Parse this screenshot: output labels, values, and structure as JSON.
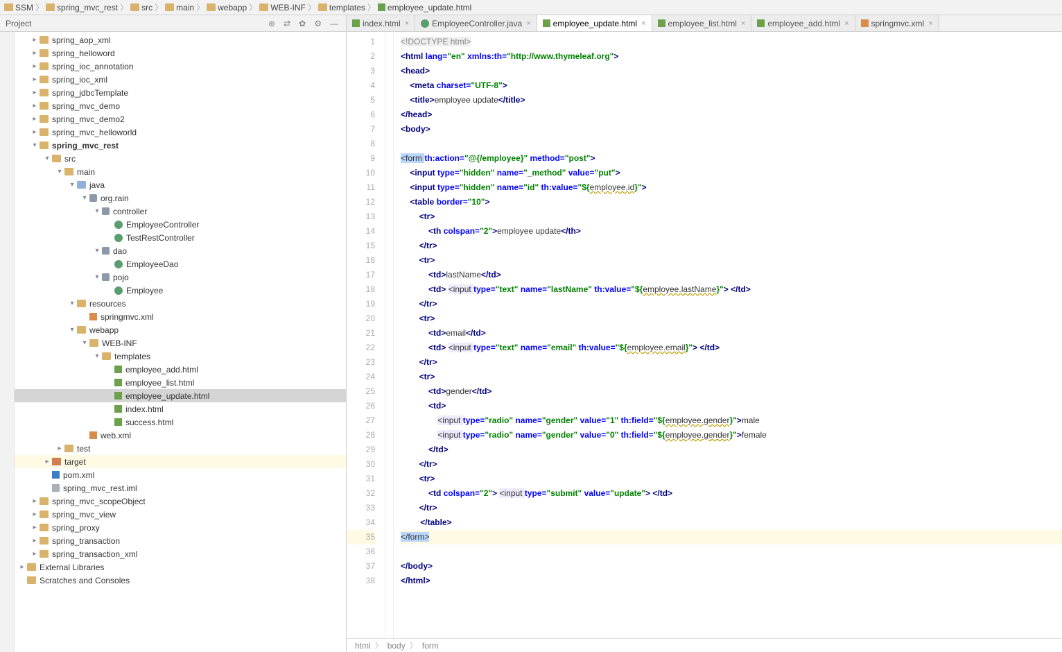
{
  "breadcrumb": [
    "SSM",
    "spring_mvc_rest",
    "src",
    "main",
    "webapp",
    "WEB-INF",
    "templates",
    "employee_update.html"
  ],
  "sidebar": {
    "title": "Project",
    "tools": [
      "⊕",
      "⇄",
      "✿",
      "⚙",
      "—"
    ]
  },
  "tree": [
    {
      "d": 1,
      "a": "col",
      "i": "i-folder",
      "t": "spring_aop_xml"
    },
    {
      "d": 1,
      "a": "col",
      "i": "i-folder",
      "t": "spring_helloword"
    },
    {
      "d": 1,
      "a": "col",
      "i": "i-folder",
      "t": "spring_ioc_annotation"
    },
    {
      "d": 1,
      "a": "col",
      "i": "i-folder",
      "t": "spring_ioc_xml"
    },
    {
      "d": 1,
      "a": "col",
      "i": "i-folder",
      "t": "spring_jdbcTemplate"
    },
    {
      "d": 1,
      "a": "col",
      "i": "i-folder",
      "t": "spring_mvc_demo"
    },
    {
      "d": 1,
      "a": "col",
      "i": "i-folder",
      "t": "spring_mvc_demo2"
    },
    {
      "d": 1,
      "a": "col",
      "i": "i-folder",
      "t": "spring_mvc_helloworld"
    },
    {
      "d": 1,
      "a": "exp",
      "i": "i-folder",
      "t": "spring_mvc_rest",
      "sel": false,
      "bold": true
    },
    {
      "d": 2,
      "a": "exp",
      "i": "i-folder",
      "t": "src"
    },
    {
      "d": 3,
      "a": "exp",
      "i": "i-folder",
      "t": "main"
    },
    {
      "d": 4,
      "a": "exp",
      "i": "i-folder-blue",
      "t": "java"
    },
    {
      "d": 5,
      "a": "exp",
      "i": "i-pkg",
      "t": "org.rain"
    },
    {
      "d": 6,
      "a": "exp",
      "i": "i-pkg",
      "t": "controller"
    },
    {
      "d": 7,
      "a": "none",
      "i": "i-class",
      "t": "EmployeeController"
    },
    {
      "d": 7,
      "a": "none",
      "i": "i-class",
      "t": "TestRestController"
    },
    {
      "d": 6,
      "a": "exp",
      "i": "i-pkg",
      "t": "dao"
    },
    {
      "d": 7,
      "a": "none",
      "i": "i-class",
      "t": "EmployeeDao"
    },
    {
      "d": 6,
      "a": "exp",
      "i": "i-pkg",
      "t": "pojo"
    },
    {
      "d": 7,
      "a": "none",
      "i": "i-class",
      "t": "Employee"
    },
    {
      "d": 4,
      "a": "exp",
      "i": "i-folder",
      "t": "resources"
    },
    {
      "d": 5,
      "a": "none",
      "i": "i-xml",
      "t": "springmvc.xml"
    },
    {
      "d": 4,
      "a": "exp",
      "i": "i-folder",
      "t": "webapp"
    },
    {
      "d": 5,
      "a": "exp",
      "i": "i-folder",
      "t": "WEB-INF"
    },
    {
      "d": 6,
      "a": "exp",
      "i": "i-folder",
      "t": "templates"
    },
    {
      "d": 7,
      "a": "none",
      "i": "i-html",
      "t": "employee_add.html"
    },
    {
      "d": 7,
      "a": "none",
      "i": "i-html",
      "t": "employee_list.html"
    },
    {
      "d": 7,
      "a": "none",
      "i": "i-html",
      "t": "employee_update.html",
      "sel": true
    },
    {
      "d": 7,
      "a": "none",
      "i": "i-html",
      "t": "index.html"
    },
    {
      "d": 7,
      "a": "none",
      "i": "i-html",
      "t": "success.html"
    },
    {
      "d": 5,
      "a": "none",
      "i": "i-xml",
      "t": "web.xml"
    },
    {
      "d": 3,
      "a": "col",
      "i": "i-folder",
      "t": "test"
    },
    {
      "d": 2,
      "a": "col",
      "i": "i-target",
      "t": "target",
      "hl": true
    },
    {
      "d": 2,
      "a": "none",
      "i": "i-m",
      "t": "pom.xml"
    },
    {
      "d": 2,
      "a": "none",
      "i": "i-iml",
      "t": "spring_mvc_rest.iml"
    },
    {
      "d": 1,
      "a": "col",
      "i": "i-folder",
      "t": "spring_mvc_scopeObject"
    },
    {
      "d": 1,
      "a": "col",
      "i": "i-folder",
      "t": "spring_mvc_view"
    },
    {
      "d": 1,
      "a": "col",
      "i": "i-folder",
      "t": "spring_proxy"
    },
    {
      "d": 1,
      "a": "col",
      "i": "i-folder",
      "t": "spring_transaction"
    },
    {
      "d": 1,
      "a": "col",
      "i": "i-folder",
      "t": "spring_transaction_xml"
    },
    {
      "d": 0,
      "a": "col",
      "i": "i-folder",
      "t": "External Libraries"
    },
    {
      "d": 0,
      "a": "none",
      "i": "i-folder",
      "t": "Scratches and Consoles"
    }
  ],
  "tabs": [
    {
      "label": "index.html",
      "icon": "i-html"
    },
    {
      "label": "EmployeeController.java",
      "icon": "i-java"
    },
    {
      "label": "employee_update.html",
      "icon": "i-html",
      "active": true
    },
    {
      "label": "employee_list.html",
      "icon": "i-html"
    },
    {
      "label": "employee_add.html",
      "icon": "i-html"
    },
    {
      "label": "springmvc.xml",
      "icon": "i-xml"
    }
  ],
  "line_count": 38,
  "caret_line": 35,
  "bulb_line": 34,
  "code": [
    [
      {
        "c": "t-gray",
        "s": "<!DOCTYPE "
      },
      {
        "c": "t-gray",
        "s": "html"
      },
      {
        "c": "t-gray",
        "s": ">"
      }
    ],
    [
      {
        "c": "t-tag",
        "s": "<html "
      },
      {
        "c": "t-attr",
        "s": "lang="
      },
      {
        "c": "t-val",
        "s": "\"en\" "
      },
      {
        "c": "t-attr",
        "s": "xmlns:th="
      },
      {
        "c": "t-val",
        "s": "\"http://www.thymeleaf.org\""
      },
      {
        "c": "t-tag",
        "s": ">"
      }
    ],
    [
      {
        "c": "t-tag",
        "s": "<head>"
      }
    ],
    [
      {
        "c": "",
        "s": "    "
      },
      {
        "c": "t-tag",
        "s": "<meta "
      },
      {
        "c": "t-attr",
        "s": "charset="
      },
      {
        "c": "t-val",
        "s": "\"UTF-8\""
      },
      {
        "c": "t-tag",
        "s": ">"
      }
    ],
    [
      {
        "c": "",
        "s": "    "
      },
      {
        "c": "t-tag",
        "s": "<title>"
      },
      {
        "c": "t-txt",
        "s": "employee update"
      },
      {
        "c": "t-tag",
        "s": "</title>"
      }
    ],
    [
      {
        "c": "t-tag",
        "s": "</head>"
      }
    ],
    [
      {
        "c": "t-tag",
        "s": "<body>"
      }
    ],
    [],
    [
      {
        "c": "t-sel",
        "s": "<form "
      },
      {
        "c": "t-attr",
        "s": "th:action="
      },
      {
        "c": "t-val",
        "s": "\"@{/employee}\" "
      },
      {
        "c": "t-attr",
        "s": "method="
      },
      {
        "c": "t-val",
        "s": "\"post\""
      },
      {
        "c": "t-tag",
        "s": ">"
      }
    ],
    [
      {
        "c": "",
        "s": "    "
      },
      {
        "c": "t-tag",
        "s": "<input "
      },
      {
        "c": "t-attr",
        "s": "type="
      },
      {
        "c": "t-val",
        "s": "\"hidden\" "
      },
      {
        "c": "t-attr",
        "s": "name="
      },
      {
        "c": "t-val",
        "s": "\"_method\" "
      },
      {
        "c": "t-attr",
        "s": "value="
      },
      {
        "c": "t-val",
        "s": "\"put\""
      },
      {
        "c": "t-tag",
        "s": ">"
      }
    ],
    [
      {
        "c": "",
        "s": "    "
      },
      {
        "c": "t-tag",
        "s": "<input "
      },
      {
        "c": "t-attr",
        "s": "type="
      },
      {
        "c": "t-val",
        "s": "\"hidden\" "
      },
      {
        "c": "t-attr",
        "s": "name="
      },
      {
        "c": "t-val",
        "s": "\"id\" "
      },
      {
        "c": "t-attr",
        "s": "th:value="
      },
      {
        "c": "t-val",
        "s": "\"${"
      },
      {
        "c": "t-warn",
        "s": "employee.id"
      },
      {
        "c": "t-val",
        "s": "}\""
      },
      {
        "c": "t-tag",
        "s": ">"
      }
    ],
    [
      {
        "c": "",
        "s": "    "
      },
      {
        "c": "t-tag",
        "s": "<table "
      },
      {
        "c": "t-attr",
        "s": "border="
      },
      {
        "c": "t-val",
        "s": "\"10\""
      },
      {
        "c": "t-tag",
        "s": ">"
      }
    ],
    [
      {
        "c": "",
        "s": "        "
      },
      {
        "c": "t-tag",
        "s": "<tr>"
      }
    ],
    [
      {
        "c": "",
        "s": "            "
      },
      {
        "c": "t-tag",
        "s": "<th "
      },
      {
        "c": "t-attr",
        "s": "colspan="
      },
      {
        "c": "t-val",
        "s": "\"2\""
      },
      {
        "c": "t-tag",
        "s": ">"
      },
      {
        "c": "t-txt",
        "s": "employee update"
      },
      {
        "c": "t-tag",
        "s": "</th>"
      }
    ],
    [
      {
        "c": "",
        "s": "        "
      },
      {
        "c": "t-tag",
        "s": "</tr>"
      }
    ],
    [
      {
        "c": "",
        "s": "        "
      },
      {
        "c": "t-tag",
        "s": "<tr>"
      }
    ],
    [
      {
        "c": "",
        "s": "            "
      },
      {
        "c": "t-tag",
        "s": "<td>"
      },
      {
        "c": "t-txt",
        "s": "lastName"
      },
      {
        "c": "t-tag",
        "s": "</td>"
      }
    ],
    [
      {
        "c": "",
        "s": "            "
      },
      {
        "c": "t-tag",
        "s": "<td>"
      },
      {
        "c": "",
        "s": " "
      },
      {
        "c": "t-hlbg",
        "s": "<input "
      },
      {
        "c": "t-attr",
        "s": "type="
      },
      {
        "c": "t-val",
        "s": "\"text\" "
      },
      {
        "c": "t-attr",
        "s": "name="
      },
      {
        "c": "t-val",
        "s": "\"lastName\" "
      },
      {
        "c": "t-attr",
        "s": "th:value="
      },
      {
        "c": "t-val",
        "s": "\"${"
      },
      {
        "c": "t-warn",
        "s": "employee.lastName"
      },
      {
        "c": "t-val",
        "s": "}\""
      },
      {
        "c": "t-tag",
        "s": ">"
      },
      {
        "c": "",
        "s": " "
      },
      {
        "c": "t-tag",
        "s": "</td>"
      }
    ],
    [
      {
        "c": "",
        "s": "        "
      },
      {
        "c": "t-tag",
        "s": "</tr>"
      }
    ],
    [
      {
        "c": "",
        "s": "        "
      },
      {
        "c": "t-tag",
        "s": "<tr>"
      }
    ],
    [
      {
        "c": "",
        "s": "            "
      },
      {
        "c": "t-tag",
        "s": "<td>"
      },
      {
        "c": "t-txt",
        "s": "email"
      },
      {
        "c": "t-tag",
        "s": "</td>"
      }
    ],
    [
      {
        "c": "",
        "s": "            "
      },
      {
        "c": "t-tag",
        "s": "<td>"
      },
      {
        "c": "",
        "s": " "
      },
      {
        "c": "t-hlbg",
        "s": "<input "
      },
      {
        "c": "t-attr",
        "s": "type="
      },
      {
        "c": "t-val",
        "s": "\"text\" "
      },
      {
        "c": "t-attr",
        "s": "name="
      },
      {
        "c": "t-val",
        "s": "\"email\" "
      },
      {
        "c": "t-attr",
        "s": "th:value="
      },
      {
        "c": "t-val",
        "s": "\"${"
      },
      {
        "c": "t-warn",
        "s": "employee.email"
      },
      {
        "c": "t-val",
        "s": "}\""
      },
      {
        "c": "t-tag",
        "s": ">"
      },
      {
        "c": "",
        "s": " "
      },
      {
        "c": "t-tag",
        "s": "</td>"
      }
    ],
    [
      {
        "c": "",
        "s": "        "
      },
      {
        "c": "t-tag",
        "s": "</tr>"
      }
    ],
    [
      {
        "c": "",
        "s": "        "
      },
      {
        "c": "t-tag",
        "s": "<tr>"
      }
    ],
    [
      {
        "c": "",
        "s": "            "
      },
      {
        "c": "t-tag",
        "s": "<td>"
      },
      {
        "c": "t-txt",
        "s": "gender"
      },
      {
        "c": "t-tag",
        "s": "</td>"
      }
    ],
    [
      {
        "c": "",
        "s": "            "
      },
      {
        "c": "t-tag",
        "s": "<td>"
      }
    ],
    [
      {
        "c": "",
        "s": "                "
      },
      {
        "c": "t-hlbg",
        "s": "<input "
      },
      {
        "c": "t-attr",
        "s": "type="
      },
      {
        "c": "t-val",
        "s": "\"radio\" "
      },
      {
        "c": "t-attr",
        "s": "name="
      },
      {
        "c": "t-val",
        "s": "\"gender\" "
      },
      {
        "c": "t-attr",
        "s": "value="
      },
      {
        "c": "t-val",
        "s": "\"1\" "
      },
      {
        "c": "t-attr",
        "s": "th:field="
      },
      {
        "c": "t-val",
        "s": "\"${"
      },
      {
        "c": "t-warn",
        "s": "employee.gender"
      },
      {
        "c": "t-val",
        "s": "}\""
      },
      {
        "c": "t-tag",
        "s": ">"
      },
      {
        "c": "t-txt",
        "s": "male"
      }
    ],
    [
      {
        "c": "",
        "s": "                "
      },
      {
        "c": "t-hlbg",
        "s": "<input "
      },
      {
        "c": "t-attr",
        "s": "type="
      },
      {
        "c": "t-val",
        "s": "\"radio\" "
      },
      {
        "c": "t-attr",
        "s": "name="
      },
      {
        "c": "t-val",
        "s": "\"gender\" "
      },
      {
        "c": "t-attr",
        "s": "value="
      },
      {
        "c": "t-val",
        "s": "\"0\" "
      },
      {
        "c": "t-attr",
        "s": "th:field="
      },
      {
        "c": "t-val",
        "s": "\"${"
      },
      {
        "c": "t-warn",
        "s": "employee.gender"
      },
      {
        "c": "t-val",
        "s": "}\""
      },
      {
        "c": "t-tag",
        "s": ">"
      },
      {
        "c": "t-txt",
        "s": "female"
      }
    ],
    [
      {
        "c": "",
        "s": "            "
      },
      {
        "c": "t-tag",
        "s": "</td>"
      }
    ],
    [
      {
        "c": "",
        "s": "        "
      },
      {
        "c": "t-tag",
        "s": "</tr>"
      }
    ],
    [
      {
        "c": "",
        "s": "        "
      },
      {
        "c": "t-tag",
        "s": "<tr>"
      }
    ],
    [
      {
        "c": "",
        "s": "            "
      },
      {
        "c": "t-tag",
        "s": "<td "
      },
      {
        "c": "t-attr",
        "s": "colspan="
      },
      {
        "c": "t-val",
        "s": "\"2\""
      },
      {
        "c": "t-tag",
        "s": ">"
      },
      {
        "c": "",
        "s": " "
      },
      {
        "c": "t-hlbg",
        "s": "<input "
      },
      {
        "c": "t-attr",
        "s": "type="
      },
      {
        "c": "t-val",
        "s": "\"submit\" "
      },
      {
        "c": "t-attr",
        "s": "value="
      },
      {
        "c": "t-val",
        "s": "\"update\""
      },
      {
        "c": "t-tag",
        "s": ">"
      },
      {
        "c": "",
        "s": " "
      },
      {
        "c": "t-tag",
        "s": "</td>"
      }
    ],
    [
      {
        "c": "",
        "s": "        "
      },
      {
        "c": "t-tag",
        "s": "</tr>"
      }
    ],
    [
      {
        "c": "",
        "s": "    "
      },
      {
        "c": "t-tag",
        "s": "</table>"
      }
    ],
    [
      {
        "c": "t-sel",
        "s": "</form>"
      }
    ],
    [],
    [
      {
        "c": "t-tag",
        "s": "</body>"
      }
    ],
    [
      {
        "c": "t-tag",
        "s": "</html>"
      }
    ]
  ],
  "ed_crumb": [
    "html",
    "body",
    "form"
  ]
}
